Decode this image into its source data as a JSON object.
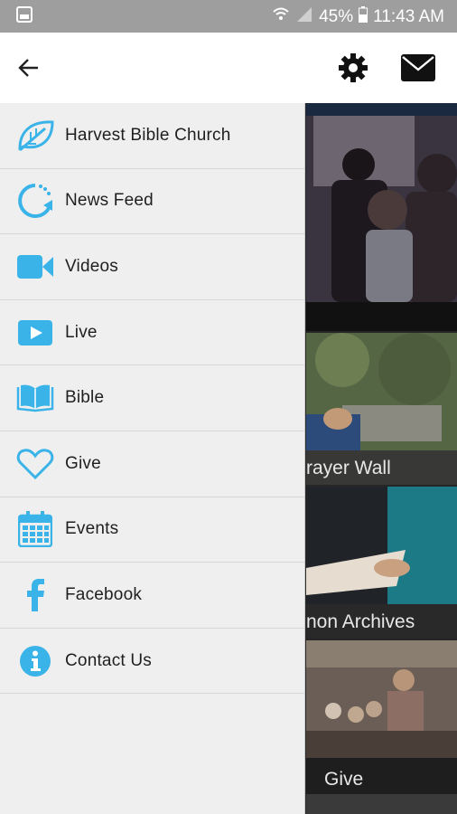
{
  "status_bar": {
    "battery": "45%",
    "time": "11:43 AM"
  },
  "app_bar": {
    "back_icon": "arrow-left-icon",
    "settings_icon": "gear-icon",
    "mail_icon": "envelope-icon"
  },
  "menu": {
    "items": [
      {
        "label": "Harvest Bible Church",
        "icon": "leaf-icon"
      },
      {
        "label": "News Feed",
        "icon": "refresh-circle-icon"
      },
      {
        "label": "Videos",
        "icon": "video-camera-icon"
      },
      {
        "label": "Live",
        "icon": "play-icon"
      },
      {
        "label": "Bible",
        "icon": "book-icon"
      },
      {
        "label": "Give",
        "icon": "heart-icon"
      },
      {
        "label": "Events",
        "icon": "calendar-icon"
      },
      {
        "label": "Facebook",
        "icon": "facebook-icon"
      },
      {
        "label": "Contact Us",
        "icon": "info-icon"
      }
    ]
  },
  "tiles": {
    "prayer_wall": "rayer Wall",
    "sermon_archives": "non Archives",
    "give": "Give"
  },
  "colors": {
    "accent": "#3ab4e8",
    "status_bar": "#9e9e9e",
    "drawer_bg": "#efefef"
  }
}
